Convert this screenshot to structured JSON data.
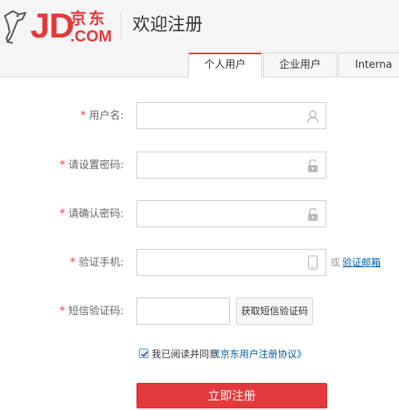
{
  "header": {
    "logo_jd": "JD",
    "logo_cn": "京东",
    "logo_com": ".COM",
    "title": "欢迎注册"
  },
  "tabs": [
    {
      "label": "个人用户",
      "active": true
    },
    {
      "label": "企业用户",
      "active": false
    },
    {
      "label": "Interna",
      "active": false
    }
  ],
  "form": {
    "required_mark": "*",
    "username": {
      "label": "用户名:",
      "value": "",
      "icon": "user-icon"
    },
    "password": {
      "label": "请设置密码:",
      "value": "",
      "icon": "lock-icon"
    },
    "confirm_password": {
      "label": "请确认密码:",
      "value": "",
      "icon": "lock-icon"
    },
    "phone": {
      "label": "验证手机:",
      "value": "",
      "icon": "mobile-phone-icon",
      "or_text": "或",
      "email_link": "验证邮箱"
    },
    "sms_code": {
      "label": "短信验证码:",
      "value": "",
      "button": "获取短信验证码"
    },
    "agreement": {
      "checked": true,
      "text": "我已阅读并同意",
      "link": "《京东用户注册协议》"
    },
    "submit": "立即注册"
  },
  "colors": {
    "brand_red": "#e4393c",
    "link_blue": "#005ea7",
    "header_bg": "#f5f5f5"
  }
}
